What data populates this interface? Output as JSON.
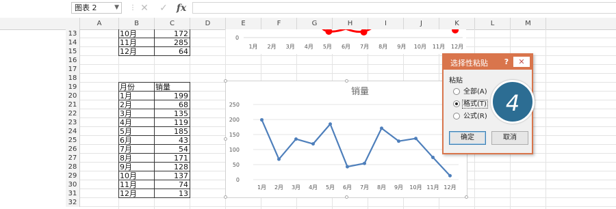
{
  "formula_bar": {
    "name_box": "图表 2",
    "cancel_icon": "close-icon",
    "enter_icon": "check-icon",
    "function_label": "fx",
    "formula": ""
  },
  "columns": [
    "A",
    "B",
    "C",
    "D",
    "E",
    "F",
    "G",
    "H",
    "I",
    "J",
    "K",
    "L",
    "M"
  ],
  "rows": [
    "13",
    "14",
    "15",
    "16",
    "17",
    "18",
    "19",
    "20",
    "21",
    "22",
    "23",
    "24",
    "25",
    "26",
    "27",
    "28",
    "29",
    "30",
    "31",
    "32"
  ],
  "top_table": [
    {
      "month": "10月",
      "value": "172"
    },
    {
      "month": "11月",
      "value": "285"
    },
    {
      "month": "12月",
      "value": "64"
    }
  ],
  "sales_table": {
    "header_month": "月份",
    "header_sales": "销量",
    "rows": [
      {
        "month": "1月",
        "value": "199"
      },
      {
        "month": "2月",
        "value": "68"
      },
      {
        "month": "3月",
        "value": "135"
      },
      {
        "month": "4月",
        "value": "119"
      },
      {
        "month": "5月",
        "value": "185"
      },
      {
        "month": "6月",
        "value": "43"
      },
      {
        "month": "7月",
        "value": "54"
      },
      {
        "month": "8月",
        "value": "171"
      },
      {
        "month": "9月",
        "value": "128"
      },
      {
        "month": "10月",
        "value": "137"
      },
      {
        "month": "11月",
        "value": "74"
      },
      {
        "month": "12月",
        "value": "13"
      }
    ]
  },
  "chart_data": [
    {
      "type": "line",
      "title": "",
      "categories": [
        "1月",
        "2月",
        "3月",
        "4月",
        "5月",
        "6月",
        "7月",
        "8月",
        "9月",
        "10月",
        "11月",
        "12月"
      ],
      "y_tick_labels": [
        "0"
      ],
      "series_color": "#ff0000",
      "note": "partially visible chart behind; only upper-right red markers near months 5–7 and 12 visible"
    },
    {
      "type": "line",
      "title": "销量",
      "categories": [
        "1月",
        "2月",
        "3月",
        "4月",
        "5月",
        "6月",
        "7月",
        "8月",
        "9月",
        "10月",
        "11月",
        "12月"
      ],
      "series": [
        {
          "values": [
            199,
            68,
            135,
            119,
            185,
            43,
            54,
            171,
            128,
            137,
            74,
            13
          ]
        }
      ],
      "ylim": [
        0,
        250
      ],
      "yticks": [
        0,
        50,
        100,
        150,
        200,
        250
      ],
      "grid": true,
      "line_color": "#4e7fbb"
    }
  ],
  "dialog": {
    "title": "选择性粘贴",
    "help_label": "?",
    "close_label": "✕",
    "group_label": "粘贴",
    "options": [
      {
        "label": "全部(A)",
        "selected": false
      },
      {
        "label": "格式(T)",
        "selected": true
      },
      {
        "label": "公式(R)",
        "selected": false
      }
    ],
    "ok_label": "确定",
    "cancel_label": "取消"
  },
  "step_badge": "4",
  "colors": {
    "dialog_accent": "#d9754c",
    "badge": "#2c6d93",
    "line": "#4e7fbb",
    "marker": "#ff0000"
  }
}
